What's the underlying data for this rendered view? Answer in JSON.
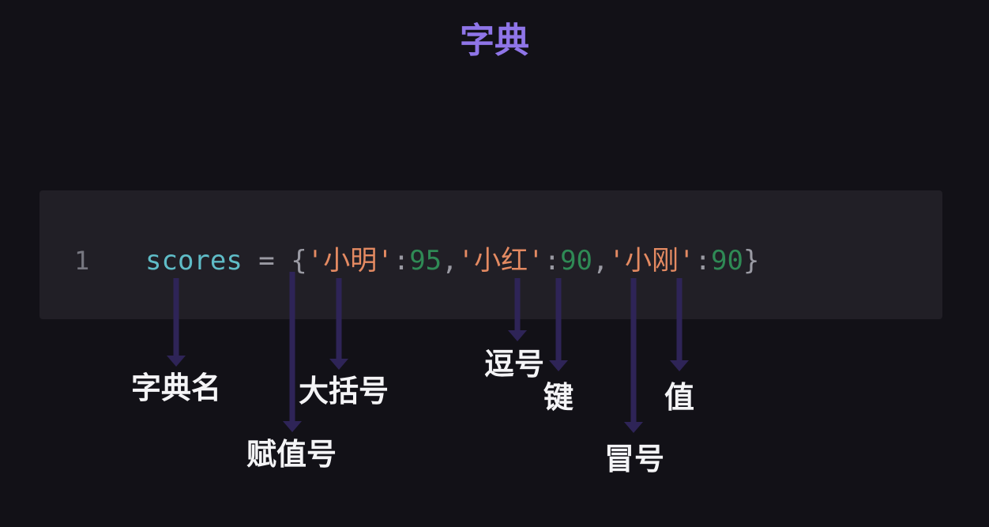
{
  "title": "字典",
  "code": {
    "line_number": "1",
    "tokens": {
      "var_name": "scores",
      "assign": " = ",
      "brace_open": "{",
      "k1_q1": "'",
      "k1": "小明",
      "k1_q2": "'",
      "colon1": ":",
      "v1": "95",
      "comma1": ",",
      "k2_q1": "'",
      "k2": "小红",
      "k2_q2": "'",
      "colon2": ":",
      "v2": "90",
      "comma2": ",",
      "k3_q1": "'",
      "k3": "小刚",
      "k3_q2": "'",
      "colon3": ":",
      "v3": "90",
      "brace_close": "}"
    }
  },
  "annotations": {
    "dict_name": "字典名",
    "assignment": "赋值号",
    "braces": "大括号",
    "comma": "逗号",
    "key": "键",
    "colon": "冒号",
    "value": "值"
  },
  "colors": {
    "background": "#121117",
    "code_background": "#211f26",
    "title": "#8f75e8",
    "line_number": "#777780",
    "variable": "#5fbcc7",
    "operator": "#9a9aa3",
    "string": "#e48a62",
    "number": "#2f8a55",
    "annotation_text": "#f4f4f6",
    "arrow": "#2e2457"
  }
}
